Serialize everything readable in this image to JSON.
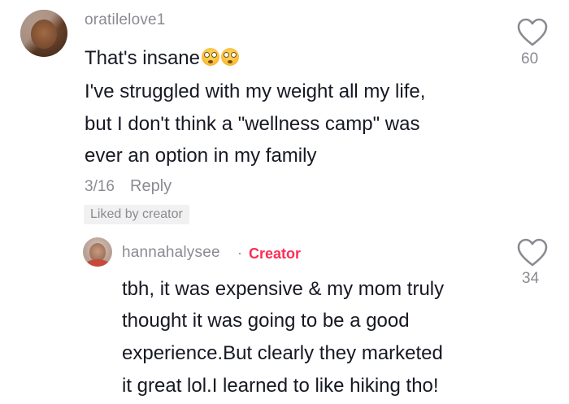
{
  "comment1": {
    "username": "oratilelove1",
    "lines": [
      "That's insane",
      "I've struggled with my weight all my life,",
      "but I don't think a \"wellness camp\" was",
      "ever an option in my family"
    ],
    "emoji_names": [
      "flushed-face-icon",
      "flushed-face-icon"
    ],
    "date": "3/16",
    "reply_label": "Reply",
    "liked_badge": "Liked by creator",
    "like_count": "60"
  },
  "comment2": {
    "username": "hannahalysee",
    "separator": "·",
    "creator_label": "Creator",
    "lines": [
      "tbh, it was expensive & my mom truly",
      "thought it was going to be a good",
      "experience.But clearly they marketed",
      "it great lol.I learned to like hiking tho!"
    ],
    "like_count": "34"
  },
  "colors": {
    "text": "#161823",
    "muted": "#8a8b91",
    "creator": "#fe2c55",
    "badge_bg": "#f1f1f2"
  }
}
